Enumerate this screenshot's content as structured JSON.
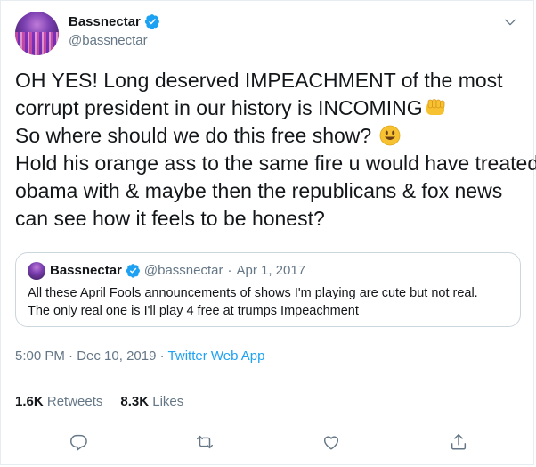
{
  "author": {
    "display_name": "Bassnectar",
    "handle": "@bassnectar",
    "verified": true
  },
  "tweet": {
    "lines": [
      "OH YES! Long deserved IMPEACHMENT of the most",
      "corrupt president in our history is INCOMING",
      "So where should we do this free show?",
      "Hold his orange ass to the same fire u would have treated",
      "obama with & maybe then the republicans & fox news",
      "can see how it feels to be honest?"
    ],
    "emojis": [
      "fist-emoji",
      "smiley-emoji"
    ]
  },
  "quoted": {
    "display_name": "Bassnectar",
    "handle": "@bassnectar",
    "separator": "·",
    "date": "Apr 1, 2017",
    "text_line1": "All these April Fools announcements of shows I'm playing are cute but not real.",
    "text_line2": "The only real one is I'll play 4 free at trumps Impeachment"
  },
  "meta": {
    "time": "5:00 PM",
    "sep1": "·",
    "date": "Dec 10, 2019",
    "sep2": "·",
    "source": "Twitter Web App"
  },
  "stats": {
    "retweets_count": "1.6K",
    "retweets_label": "Retweets",
    "likes_count": "8.3K",
    "likes_label": "Likes"
  },
  "actions": [
    "reply-icon",
    "retweet-icon",
    "like-icon",
    "share-icon"
  ],
  "colors": {
    "accent": "#1da1f2",
    "text": "#14171a",
    "muted": "#657786",
    "border": "#e6ecf0"
  }
}
